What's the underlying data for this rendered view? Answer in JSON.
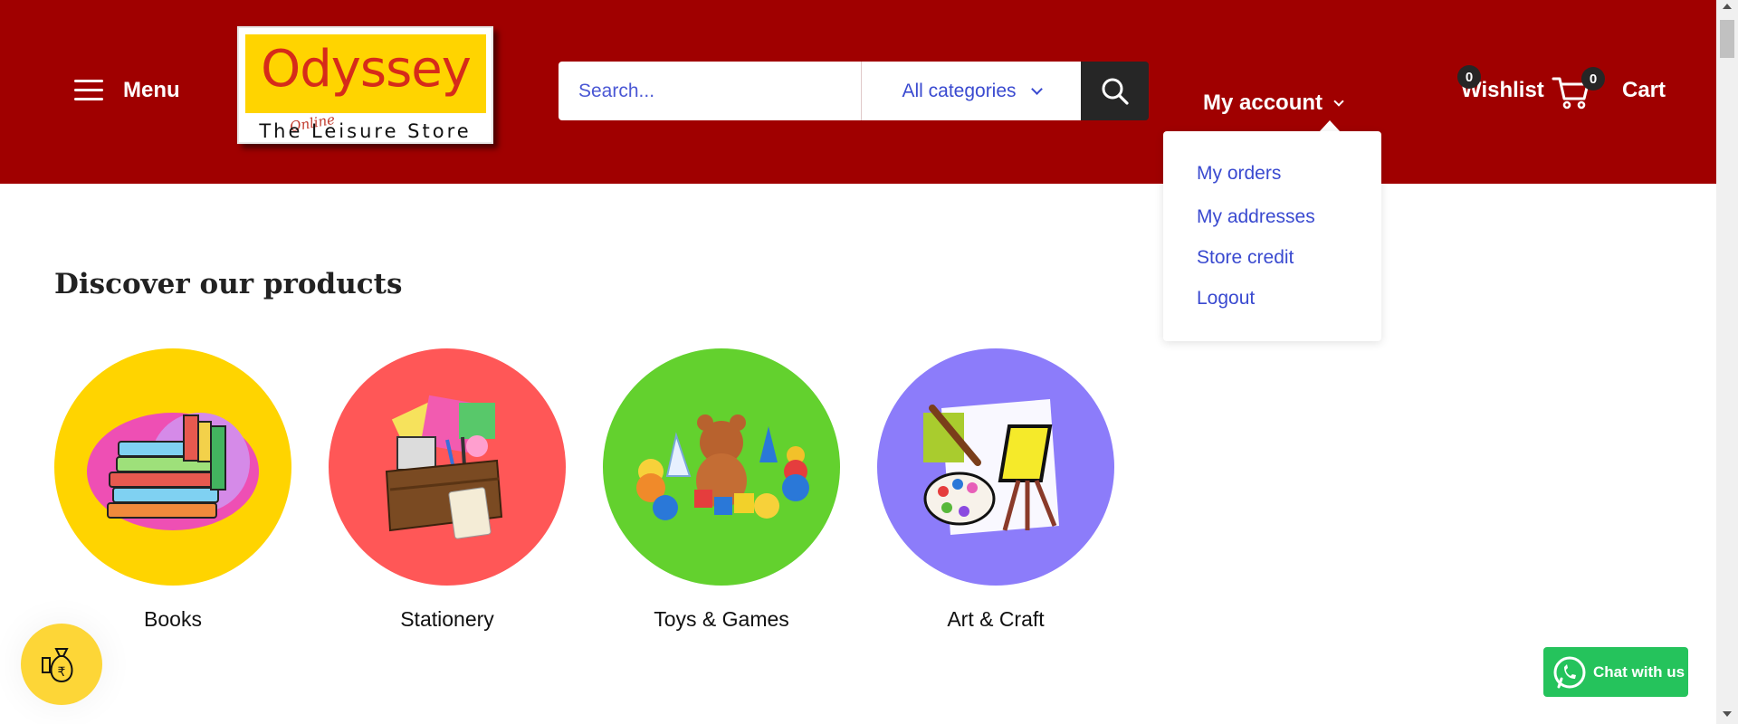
{
  "header": {
    "menu_label": "Menu",
    "logo": {
      "name": "Odyssey",
      "tagline": "The Leisure Store",
      "tagline_script": "Online"
    },
    "search": {
      "placeholder": "Search...",
      "category": "All categories"
    },
    "account_label": "My account",
    "account_menu": [
      "My orders",
      "My addresses",
      "Store credit",
      "Logout"
    ],
    "wishlist_label": "Wishlist",
    "wishlist_count": "0",
    "cart_label": "Cart",
    "cart_count": "0"
  },
  "main": {
    "section_title": "Discover our products",
    "categories": [
      {
        "label": "Books",
        "color": "#ffd400"
      },
      {
        "label": "Stationery",
        "color": "#ff5757"
      },
      {
        "label": "Toys & Games",
        "color": "#63d12e"
      },
      {
        "label": "Art & Craft",
        "color": "#8c7cfa"
      }
    ]
  },
  "floating": {
    "chat_label": "Chat with us"
  },
  "colors": {
    "header_bg": "#a00000",
    "link_blue": "#3a4ad0",
    "dark": "#262626",
    "chat_green": "#25c35c",
    "rupee_yellow": "#fdd637"
  },
  "icons": [
    "menu-icon",
    "search-icon",
    "chevron-down-icon",
    "cart-icon",
    "rupee-bag-icon",
    "whatsapp-icon"
  ]
}
